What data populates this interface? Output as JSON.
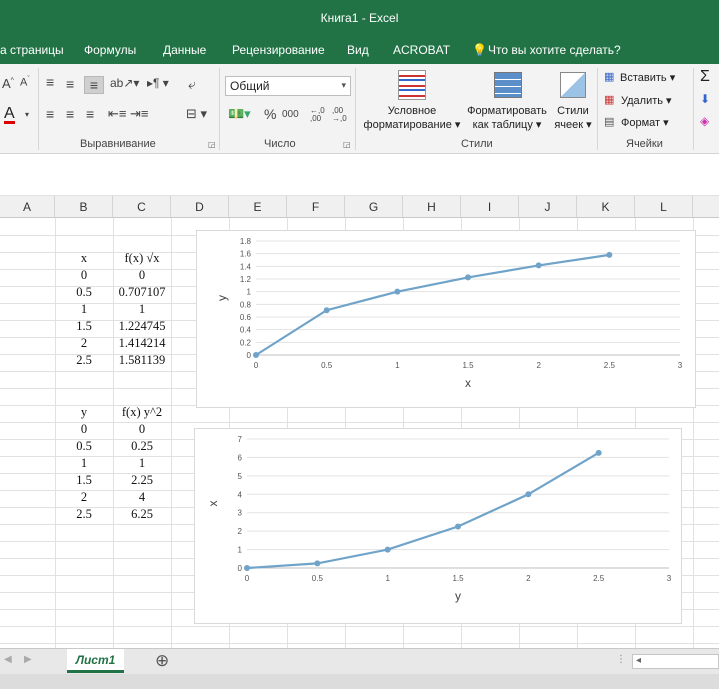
{
  "window": {
    "title": "Книга1  -  Excel"
  },
  "menu": [
    "а страницы",
    "Формулы",
    "Данные",
    "Рецензирование",
    "Вид",
    "ACROBAT",
    "Что вы хотите сделать?"
  ],
  "ribbon": {
    "number_format": "Общий",
    "percent": "%",
    "thousands": "000",
    "dec_inc": "←,0 ,00",
    "dec_dec": ",00 →,0",
    "conditional_line1": "Условное",
    "conditional_line2": "форматирование",
    "format_table_line1": "Форматировать",
    "format_table_line2": "как таблицу",
    "styles_line1": "Стили",
    "styles_line2": "ячеек",
    "insert": "Вставить",
    "delete": "Удалить",
    "format": "Формат",
    "groups": {
      "alignment": "Выравнивание",
      "number": "Число",
      "styles": "Стили",
      "cells": "Ячейки"
    },
    "font_a": "A",
    "sigma": "Σ"
  },
  "columns": [
    "A",
    "B",
    "C",
    "D",
    "E",
    "F",
    "G",
    "H",
    "I",
    "J",
    "K",
    "L"
  ],
  "table1": {
    "headers": [
      "x",
      "f(x) √x"
    ],
    "rows": [
      [
        "0",
        "0"
      ],
      [
        "0.5",
        "0.707107"
      ],
      [
        "1",
        "1"
      ],
      [
        "1.5",
        "1.224745"
      ],
      [
        "2",
        "1.414214"
      ],
      [
        "2.5",
        "1.581139"
      ]
    ]
  },
  "table2": {
    "headers": [
      "y",
      "f(x) y^2"
    ],
    "rows": [
      [
        "0",
        "0"
      ],
      [
        "0.5",
        "0.25"
      ],
      [
        "1",
        "1"
      ],
      [
        "1.5",
        "2.25"
      ],
      [
        "2",
        "4"
      ],
      [
        "2.5",
        "6.25"
      ]
    ]
  },
  "chart_data": [
    {
      "type": "line",
      "title": "",
      "xlabel": "x",
      "ylabel": "y",
      "x": [
        0,
        0.5,
        1,
        1.5,
        2,
        2.5
      ],
      "series": [
        {
          "values": [
            0,
            0.707107,
            1,
            1.224745,
            1.414214,
            1.581139
          ]
        }
      ],
      "xlim": [
        0,
        3
      ],
      "ylim": [
        0,
        1.8
      ],
      "xticks": [
        "0",
        "0.5",
        "1",
        "1.5",
        "2",
        "2.5",
        "3"
      ],
      "yticks": [
        "0",
        "0.2",
        "0.4",
        "0.6",
        "0.8",
        "1",
        "1.2",
        "1.4",
        "1.6",
        "1.8"
      ],
      "grid": true,
      "color": "#6fa3c9"
    },
    {
      "type": "line",
      "title": "",
      "xlabel": "y",
      "ylabel": "x",
      "x": [
        0,
        0.5,
        1,
        1.5,
        2,
        2.5
      ],
      "series": [
        {
          "values": [
            0,
            0.25,
            1,
            2.25,
            4,
            6.25
          ]
        }
      ],
      "xlim": [
        0,
        3
      ],
      "ylim": [
        0,
        7
      ],
      "xticks": [
        "0",
        "0.5",
        "1",
        "1.5",
        "2",
        "2.5",
        "3"
      ],
      "yticks": [
        "0",
        "1",
        "2",
        "3",
        "4",
        "5",
        "6",
        "7"
      ],
      "grid": true,
      "color": "#6fa3c9"
    }
  ],
  "sheet_tab": "Лист1",
  "add_sheet": "⊕",
  "colors": {
    "excel_green": "#217346",
    "series": "#6fa3c9"
  }
}
